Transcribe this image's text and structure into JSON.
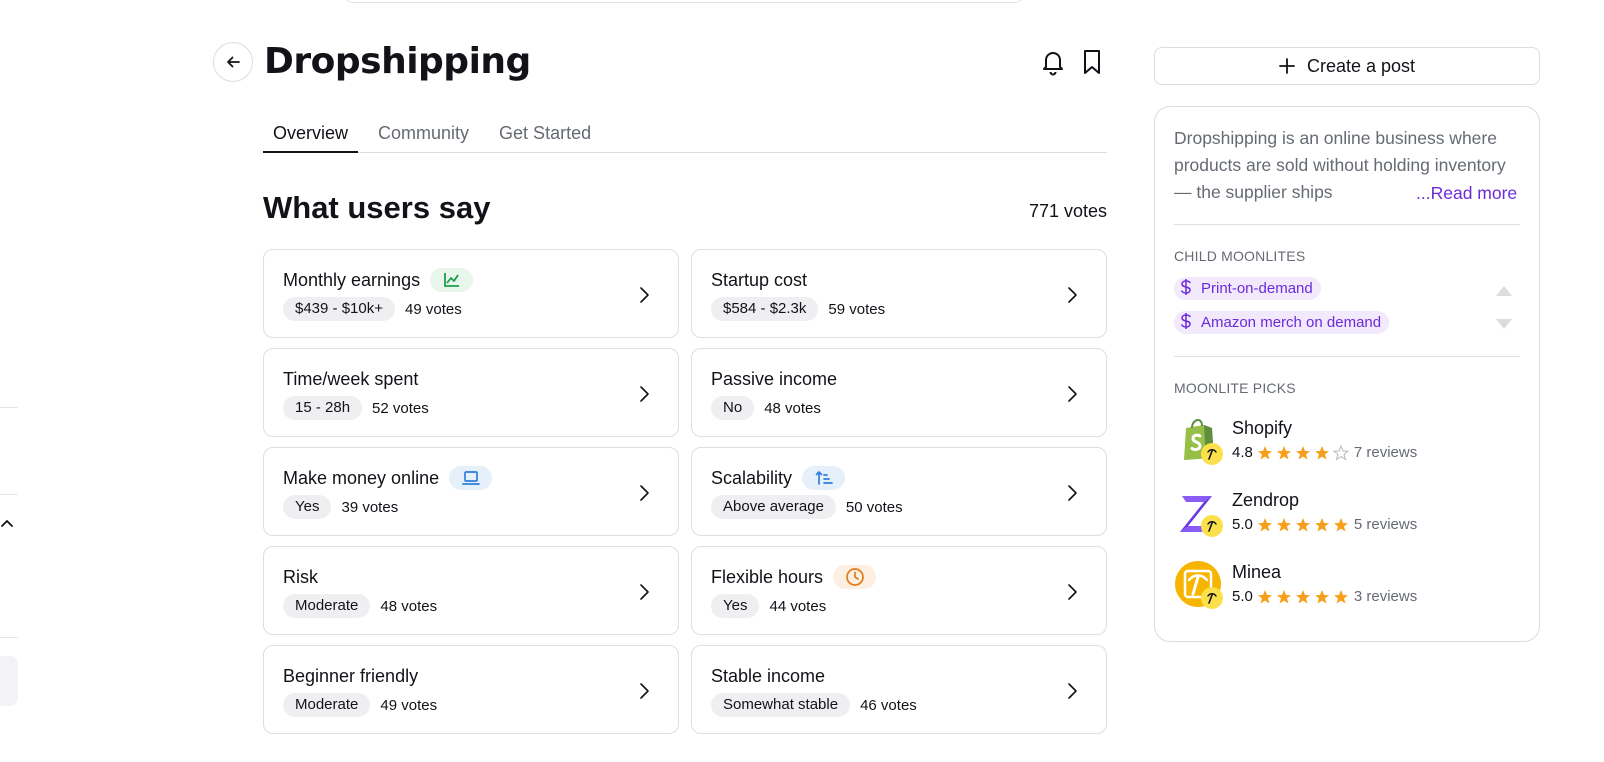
{
  "header": {
    "title": "Dropshipping",
    "back_icon": "arrow-left-icon",
    "icons": [
      "bell-icon",
      "bookmark-icon"
    ]
  },
  "tabs": [
    {
      "label": "Overview",
      "active": true
    },
    {
      "label": "Community",
      "active": false
    },
    {
      "label": "Get Started",
      "active": false
    }
  ],
  "section": {
    "title": "What users say",
    "votes_total": "771 votes"
  },
  "cards": [
    {
      "title": "Monthly earnings",
      "icon": "chart-line-icon",
      "chip": "$439 - $10k+",
      "votes": "49 votes"
    },
    {
      "title": "Startup cost",
      "chip": "$584 - $2.3k",
      "votes": "59 votes"
    },
    {
      "title": "Time/week spent",
      "chip": "15 - 28h",
      "votes": "52 votes"
    },
    {
      "title": "Passive income",
      "chip": "No",
      "votes": "48 votes"
    },
    {
      "title": "Make money online",
      "icon": "laptop-icon",
      "chip": "Yes",
      "votes": "39 votes"
    },
    {
      "title": "Scalability",
      "icon": "sort-ascending-icon",
      "chip": "Above average",
      "votes": "50 votes"
    },
    {
      "title": "Risk",
      "chip": "Moderate",
      "votes": "48 votes"
    },
    {
      "title": "Flexible hours",
      "icon": "clock-icon",
      "chip": "Yes",
      "votes": "44 votes"
    },
    {
      "title": "Beginner friendly",
      "chip": "Moderate",
      "votes": "49 votes"
    },
    {
      "title": "Stable income",
      "chip": "Somewhat stable",
      "votes": "46 votes"
    }
  ],
  "sidebar": {
    "create_post_label": "Create a post",
    "description": "Dropshipping is an online business where products are sold without holding inventory — the supplier ships",
    "read_more": "...Read more",
    "child_label": "CHILD MOONLITES",
    "children": [
      "Print-on-demand",
      "Amazon merch on demand"
    ],
    "picks_label": "MOONLITE PICKS",
    "picks": [
      {
        "name": "Shopify",
        "rating": "4.8",
        "stars": 4,
        "reviews": "7 reviews",
        "logo": "shopify-logo-icon"
      },
      {
        "name": "Zendrop",
        "rating": "5.0",
        "stars": 5,
        "reviews": "5 reviews",
        "logo": "zendrop-logo-icon"
      },
      {
        "name": "Minea",
        "rating": "5.0",
        "stars": 5,
        "reviews": "3 reviews",
        "logo": "minea-logo-icon"
      }
    ]
  },
  "colors": {
    "accent_purple": "#6b2bd9",
    "star_orange": "#f59f1a",
    "badge_green": "#1e9e4a",
    "badge_blue": "#2f7fdc",
    "badge_orange": "#e07b1a"
  }
}
